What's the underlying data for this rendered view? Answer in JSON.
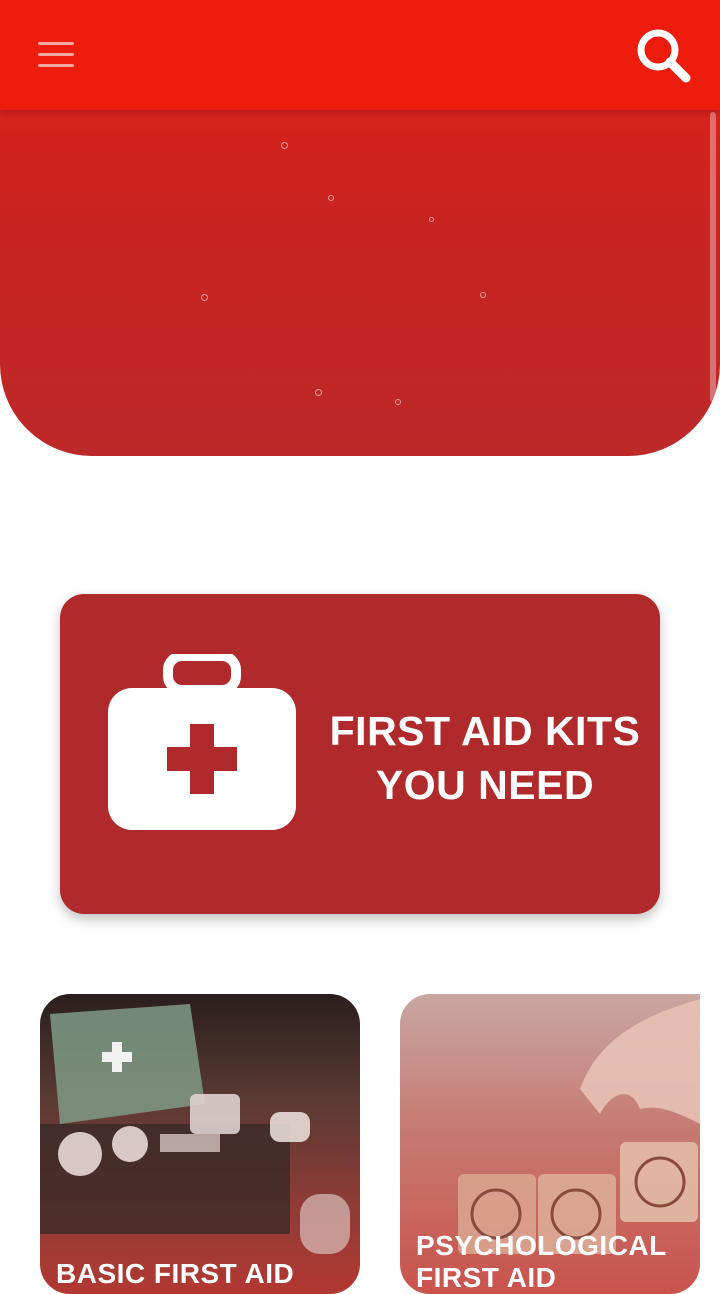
{
  "app": {
    "menu_icon": "hamburger-menu-icon",
    "search_icon": "search-icon",
    "accent_color": "#ee1c0d"
  },
  "banner": {
    "title_line1": "FIRST AID KITS",
    "title_line2": "YOU NEED",
    "icon": "first-aid-kit-icon",
    "color": "#b0292b"
  },
  "cards": [
    {
      "title": "BASIC FIRST AID",
      "image": "first-aid-kit-photo"
    },
    {
      "title": "PSYCHOLOGICAL FIRST AID",
      "image": "emotion-blocks-photo"
    }
  ]
}
